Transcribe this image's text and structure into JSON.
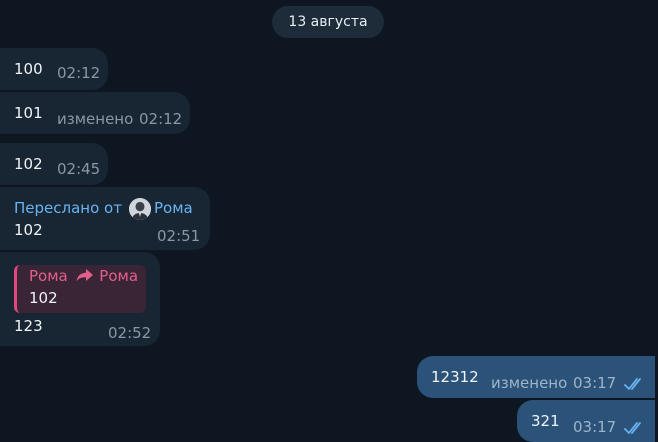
{
  "date_label": "13 августа",
  "messages": [
    {
      "text": "100",
      "time": "02:12"
    },
    {
      "text": "101",
      "edited": "изменено",
      "time": "02:12"
    },
    {
      "text": "102",
      "time": "02:45"
    },
    {
      "forwarded_prefix": "Переслано от",
      "forwarded_name": "Рома",
      "text": "102",
      "time": "02:51"
    },
    {
      "reply_from": "Рома",
      "reply_to": "Рома",
      "reply_text": "102",
      "text": "123",
      "time": "02:52"
    },
    {
      "text": "12312",
      "edited": "изменено",
      "time": "03:17",
      "status": "read"
    },
    {
      "text": "321",
      "time": "03:17",
      "status": "read"
    }
  ],
  "colors": {
    "background": "#0e1621",
    "incoming": "#182533",
    "outgoing": "#2b5278",
    "link": "#6ab3f3",
    "reply_accent": "#e0487d"
  },
  "icons": {
    "reply_arrow": "share-arrow-icon",
    "read_status": "double-check-icon"
  }
}
